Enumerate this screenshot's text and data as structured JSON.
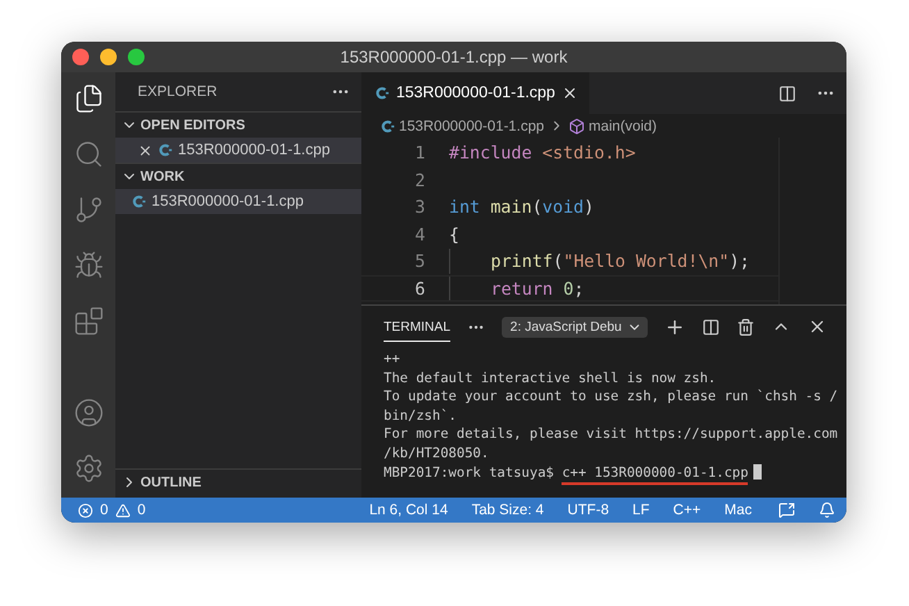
{
  "window": {
    "title": "153R000000-01-1.cpp — work"
  },
  "activity_bar": [
    {
      "kind": "files",
      "selected": true
    },
    {
      "kind": "search",
      "selected": false
    },
    {
      "kind": "source",
      "selected": false
    },
    {
      "kind": "debug",
      "selected": false
    },
    {
      "kind": "extensions",
      "selected": false
    }
  ],
  "sidebar": {
    "title": "EXPLORER",
    "sections": [
      {
        "title": "OPEN EDITORS",
        "expanded": true,
        "items": [
          {
            "name": "153R000000-01-1.cpp",
            "closable": true,
            "selected": true
          }
        ]
      },
      {
        "title": "WORK",
        "expanded": true,
        "items": [
          {
            "name": "153R000000-01-1.cpp",
            "closable": false,
            "selected": true
          }
        ]
      }
    ],
    "outline": {
      "title": "OUTLINE",
      "expanded": false
    }
  },
  "editor": {
    "tab": {
      "label": "153R000000-01-1.cpp"
    },
    "breadcrumb": {
      "file": "153R000000-01-1.cpp",
      "symbol": "main(void)"
    },
    "lines": [
      {
        "number": "1",
        "current": false,
        "tokens": [
          {
            "kind": "directive",
            "text": "#include "
          },
          {
            "kind": "string",
            "text": "<stdio.h>"
          }
        ]
      },
      {
        "number": "2",
        "current": false
      },
      {
        "number": "3",
        "current": false,
        "tokens": [
          {
            "kind": "keyword",
            "text": "int "
          },
          {
            "kind": "function",
            "text": "main"
          },
          {
            "kind": "plain",
            "text": "("
          },
          {
            "kind": "keyword",
            "text": "void"
          },
          {
            "kind": "plain",
            "text": ")"
          }
        ]
      },
      {
        "number": "4",
        "current": false,
        "tokens": [
          {
            "kind": "plain",
            "text": "{"
          }
        ]
      },
      {
        "number": "5",
        "current": false,
        "indented": true,
        "tokens": [
          {
            "kind": "function",
            "text": "printf"
          },
          {
            "kind": "plain",
            "text": "("
          },
          {
            "kind": "string",
            "text": "\"Hello World!\\n\""
          },
          {
            "kind": "plain",
            "text": ");"
          }
        ]
      },
      {
        "number": "6",
        "current": true,
        "indented": true,
        "tokens": [
          {
            "kind": "directive",
            "text": "return "
          },
          {
            "kind": "number",
            "text": "0"
          },
          {
            "kind": "plain",
            "text": ";"
          }
        ]
      }
    ]
  },
  "panel": {
    "tab": "TERMINAL",
    "terminal_select": "2: JavaScript Debu",
    "lines": [
      "++",
      "The default interactive shell is now zsh.",
      "To update your account to use zsh, please run `chsh -s /",
      "bin/zsh`.",
      "For more details, please visit https://support.apple.com",
      "/kb/HT208050."
    ],
    "prompt": "MBP2017:work tatsuya$ ",
    "command": "c++ 153R000000-01-1.cpp",
    "command_underlined": true
  },
  "status_bar": {
    "errors": "0",
    "warnings": "0",
    "items": [
      "Ln 6, Col 14",
      "Tab Size: 4",
      "UTF-8",
      "LF",
      "C++",
      "Mac"
    ]
  }
}
